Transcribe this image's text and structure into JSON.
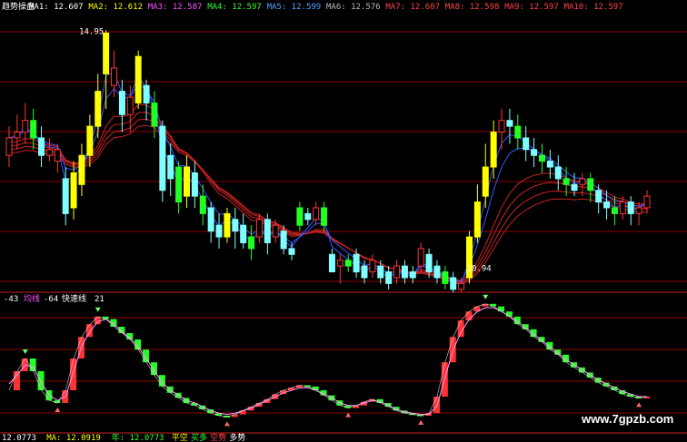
{
  "header": {
    "title": "趋势操盘",
    "ma_items": [
      {
        "label": "MA1: 12.607",
        "color": "#ffffff"
      },
      {
        "label": "MA2: 12.612",
        "color": "#ffff00"
      },
      {
        "label": "MA3: 12.587",
        "color": "#ff55ff"
      },
      {
        "label": "MA4: 12.597",
        "color": "#33ff33"
      },
      {
        "label": "MA5: 12.599",
        "color": "#4ea3ff"
      },
      {
        "label": "MA6: 12.576",
        "color": "#bbbbbb"
      },
      {
        "label": "MA7: 12.607",
        "color": "#ff4444"
      },
      {
        "label": "MA8: 12.598",
        "color": "#ff4444"
      },
      {
        "label": "MA9: 12.597",
        "color": "#ff4444"
      },
      {
        "label": "MA10: 12.597",
        "color": "#ff4444"
      }
    ]
  },
  "sub_header": {
    "t1": "-43",
    "t2": "均线",
    "t3": "-64",
    "t4": "快速线",
    "t5": "21"
  },
  "footer": {
    "items": [
      {
        "label": "12.0773",
        "color": "#ffffff"
      },
      {
        "label": "MA: 12.0919",
        "color": "#ffff00"
      },
      {
        "label": "年: 12.0773",
        "color": "#33ff33"
      },
      {
        "label": "平空",
        "color": "#ffff00"
      },
      {
        "label": "买多",
        "color": "#33ff33"
      },
      {
        "label": "空势",
        "color": "#ff4444"
      },
      {
        "label": "多势",
        "color": "#ffffff"
      }
    ]
  },
  "watermark": "www.7gpzb.com",
  "colors": {
    "bg": "#000000",
    "grid": "#8b0000",
    "up": "#ff3333",
    "down": "#7fffff",
    "yellow": "#ffff00",
    "green": "#22ff22",
    "ribbon": "#cc2222",
    "fast_ma": "#3355ff",
    "k_line": "#ff99ff",
    "d_line": "#dddddd"
  },
  "chart_data": [
    {
      "type": "candlestick",
      "title": "趋势操盘",
      "ylim": [
        10.45,
        15.25
      ],
      "annotations": [
        {
          "text": "14.95",
          "x": 8,
          "y": 14.95
        },
        {
          "text": "10.94",
          "x": 56,
          "y": 10.94
        }
      ],
      "candles": [
        [
          12.8,
          13.1,
          13.3,
          12.6
        ],
        [
          13.1,
          13.2,
          13.5,
          12.9
        ],
        [
          13.2,
          13.4,
          13.7,
          13.0
        ],
        [
          13.4,
          13.1,
          13.6,
          12.9
        ],
        [
          13.1,
          12.8,
          13.3,
          12.6
        ],
        [
          12.8,
          12.9,
          13.1,
          12.7
        ],
        [
          12.7,
          12.9,
          13.0,
          12.5
        ],
        [
          12.4,
          11.8,
          12.6,
          11.6
        ],
        [
          11.9,
          12.5,
          12.7,
          11.7
        ],
        [
          12.3,
          12.8,
          13.0,
          12.1
        ],
        [
          12.8,
          13.3,
          13.5,
          12.6
        ],
        [
          13.3,
          13.9,
          14.2,
          13.1
        ],
        [
          14.2,
          14.9,
          14.95,
          13.6
        ],
        [
          14.0,
          14.3,
          14.6,
          13.8
        ],
        [
          13.9,
          13.5,
          14.1,
          13.2
        ],
        [
          13.5,
          13.8,
          14.0,
          13.2
        ],
        [
          13.7,
          14.5,
          14.6,
          13.6
        ],
        [
          14.0,
          13.7,
          14.1,
          13.4
        ],
        [
          13.7,
          13.3,
          13.9,
          13.1
        ],
        [
          13.3,
          12.2,
          13.4,
          12.0
        ],
        [
          12.8,
          12.4,
          13.0,
          12.1
        ],
        [
          12.6,
          12.0,
          12.7,
          11.8
        ],
        [
          12.1,
          12.6,
          12.8,
          11.9
        ],
        [
          12.5,
          12.1,
          12.7,
          11.9
        ],
        [
          12.1,
          11.8,
          12.3,
          11.6
        ],
        [
          11.9,
          11.5,
          12.0,
          11.3
        ],
        [
          11.6,
          11.4,
          11.8,
          11.2
        ],
        [
          11.4,
          11.8,
          11.9,
          11.3
        ],
        [
          11.7,
          11.5,
          11.9,
          11.2
        ],
        [
          11.6,
          11.3,
          11.8,
          11.2
        ],
        [
          11.4,
          11.2,
          11.6,
          11.0
        ],
        [
          11.4,
          11.7,
          11.8,
          11.3
        ],
        [
          11.7,
          11.3,
          11.8,
          11.1
        ],
        [
          11.4,
          11.6,
          11.7,
          11.3
        ],
        [
          11.5,
          11.2,
          11.6,
          11.1
        ],
        [
          11.2,
          11.1,
          11.3,
          11.0
        ],
        [
          11.9,
          11.6,
          12.0,
          11.5
        ],
        [
          11.8,
          11.7,
          11.9,
          11.6
        ],
        [
          11.7,
          11.9,
          12.0,
          11.6
        ],
        [
          11.9,
          11.6,
          12.0,
          11.5
        ],
        [
          11.1,
          10.8,
          11.2,
          10.8
        ],
        [
          10.9,
          11.0,
          11.1,
          10.6
        ],
        [
          11.0,
          10.9,
          11.1,
          10.8
        ],
        [
          11.1,
          10.8,
          11.2,
          10.7
        ],
        [
          10.9,
          10.7,
          11.0,
          10.6
        ],
        [
          10.8,
          11.0,
          11.1,
          10.7
        ],
        [
          10.9,
          10.7,
          11.0,
          10.6
        ],
        [
          10.8,
          10.6,
          10.9,
          10.5
        ],
        [
          10.7,
          10.9,
          11.0,
          10.6
        ],
        [
          10.9,
          10.7,
          11.0,
          10.6
        ],
        [
          10.8,
          10.7,
          10.9,
          10.6
        ],
        [
          10.9,
          11.2,
          11.3,
          10.8
        ],
        [
          11.1,
          10.8,
          11.2,
          10.7
        ],
        [
          10.9,
          10.7,
          11.0,
          10.6
        ],
        [
          10.8,
          10.6,
          10.9,
          10.5
        ],
        [
          10.7,
          10.5,
          10.8,
          10.45
        ],
        [
          10.5,
          10.6,
          10.7,
          10.45
        ],
        [
          10.7,
          11.4,
          11.5,
          10.6
        ],
        [
          11.4,
          12.0,
          12.3,
          11.3
        ],
        [
          12.1,
          12.6,
          13.0,
          11.9
        ],
        [
          12.6,
          13.2,
          13.4,
          12.4
        ],
        [
          13.2,
          13.4,
          13.6,
          12.9
        ],
        [
          13.4,
          13.3,
          13.6,
          13.0
        ],
        [
          13.3,
          13.1,
          13.5,
          12.9
        ],
        [
          13.1,
          12.9,
          13.3,
          12.7
        ],
        [
          12.9,
          12.8,
          13.1,
          12.6
        ],
        [
          12.8,
          12.7,
          13.0,
          12.5
        ],
        [
          12.7,
          12.6,
          12.9,
          12.4
        ],
        [
          12.6,
          12.4,
          12.8,
          12.2
        ],
        [
          12.4,
          12.3,
          12.6,
          12.1
        ],
        [
          12.3,
          12.2,
          12.5,
          12.1
        ],
        [
          12.3,
          12.4,
          12.5,
          12.1
        ],
        [
          12.4,
          12.2,
          12.5,
          12.0
        ],
        [
          12.2,
          12.0,
          12.3,
          11.8
        ],
        [
          12.0,
          11.9,
          12.2,
          11.7
        ],
        [
          11.9,
          11.8,
          12.1,
          11.6
        ],
        [
          11.8,
          12.0,
          12.1,
          11.7
        ],
        [
          12.0,
          11.8,
          12.1,
          11.6
        ],
        [
          11.8,
          11.9,
          12.0,
          11.6
        ],
        [
          11.9,
          12.1,
          12.2,
          11.8
        ]
      ]
    },
    {
      "type": "line",
      "title": "",
      "ylim": [
        0,
        100
      ],
      "series": [
        {
          "values": [
            30,
            45,
            55,
            45,
            30,
            22,
            20,
            30,
            55,
            72,
            82,
            88,
            86,
            80,
            75,
            70,
            62,
            52,
            42,
            33,
            28,
            24,
            20,
            18,
            15,
            12,
            10,
            9,
            11,
            14,
            17,
            20,
            23,
            27,
            30,
            32,
            34,
            33,
            30,
            26,
            22,
            18,
            16,
            18,
            21,
            23,
            20,
            17,
            14,
            12,
            11,
            10,
            12,
            25,
            52,
            72,
            85,
            92,
            96,
            98,
            96,
            92,
            88,
            82,
            78,
            72,
            68,
            62,
            58,
            52,
            48,
            44,
            40,
            36,
            33,
            30,
            27,
            25,
            24,
            25
          ]
        },
        {
          "values": [
            35,
            42,
            50,
            48,
            36,
            26,
            22,
            25,
            45,
            65,
            76,
            84,
            86,
            82,
            76,
            71,
            64,
            55,
            45,
            36,
            30,
            26,
            22,
            20,
            17,
            14,
            12,
            11,
            12,
            14,
            16,
            19,
            22,
            25,
            28,
            30,
            32,
            32,
            30,
            27,
            24,
            20,
            18,
            18,
            20,
            22,
            21,
            18,
            15,
            13,
            12,
            11,
            11,
            18,
            40,
            62,
            76,
            86,
            92,
            95,
            95,
            92,
            88,
            84,
            79,
            74,
            69,
            64,
            59,
            54,
            50,
            46,
            42,
            38,
            35,
            32,
            29,
            27,
            25,
            25
          ]
        }
      ]
    }
  ]
}
